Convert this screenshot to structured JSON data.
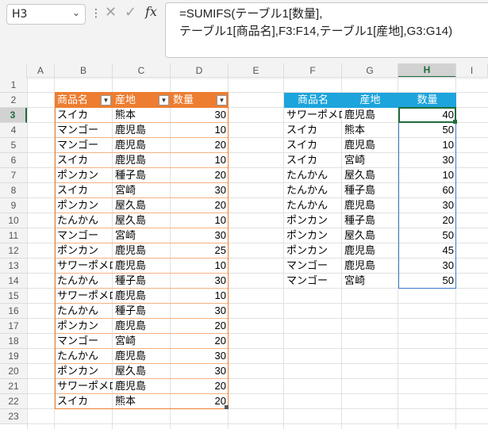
{
  "name_box": {
    "value": "H3"
  },
  "formula_bar": {
    "separator": "⋮",
    "cancel_icon": "✕",
    "confirm_icon": "✓",
    "fx_label": "fx",
    "formula": "=SUMIFS(テーブル1[数量],\nテーブル1[商品名],F3:F14,テーブル1[産地],G3:G14)"
  },
  "columns": [
    "A",
    "B",
    "C",
    "D",
    "E",
    "F",
    "G",
    "H",
    "I"
  ],
  "selected_column": "H",
  "rows": [
    "1",
    "2",
    "3",
    "4",
    "5",
    "6",
    "7",
    "8",
    "9",
    "10",
    "11",
    "12",
    "13",
    "14",
    "15",
    "16",
    "17",
    "18",
    "19",
    "20",
    "21",
    "22",
    "23"
  ],
  "selected_row": "3",
  "table1": {
    "headers": [
      "商品名",
      "産地",
      "数量"
    ],
    "dropdown_icon": "▼",
    "rows": [
      [
        "スイカ",
        "熊本",
        "30"
      ],
      [
        "マンゴー",
        "鹿児島",
        "10"
      ],
      [
        "マンゴー",
        "鹿児島",
        "20"
      ],
      [
        "スイカ",
        "鹿児島",
        "10"
      ],
      [
        "ポンカン",
        "種子島",
        "20"
      ],
      [
        "スイカ",
        "宮崎",
        "30"
      ],
      [
        "ポンカン",
        "屋久島",
        "20"
      ],
      [
        "たんかん",
        "屋久島",
        "10"
      ],
      [
        "マンゴー",
        "宮崎",
        "30"
      ],
      [
        "ポンカン",
        "鹿児島",
        "25"
      ],
      [
        "サワーポメロ",
        "鹿児島",
        "10"
      ],
      [
        "たんかん",
        "種子島",
        "30"
      ],
      [
        "サワーポメロ",
        "鹿児島",
        "10"
      ],
      [
        "たんかん",
        "種子島",
        "30"
      ],
      [
        "ポンカン",
        "鹿児島",
        "20"
      ],
      [
        "マンゴー",
        "宮崎",
        "20"
      ],
      [
        "たんかん",
        "鹿児島",
        "30"
      ],
      [
        "ポンカン",
        "屋久島",
        "30"
      ],
      [
        "サワーポメロ",
        "鹿児島",
        "20"
      ],
      [
        "スイカ",
        "熊本",
        "20"
      ]
    ]
  },
  "summary": {
    "headers": [
      "商品名",
      "産地",
      "数量"
    ],
    "rows": [
      [
        "サワーポメロ",
        "鹿児島",
        "40"
      ],
      [
        "スイカ",
        "熊本",
        "50"
      ],
      [
        "スイカ",
        "鹿児島",
        "10"
      ],
      [
        "スイカ",
        "宮崎",
        "30"
      ],
      [
        "たんかん",
        "屋久島",
        "10"
      ],
      [
        "たんかん",
        "種子島",
        "60"
      ],
      [
        "たんかん",
        "鹿児島",
        "30"
      ],
      [
        "ポンカン",
        "種子島",
        "20"
      ],
      [
        "ポンカン",
        "屋久島",
        "50"
      ],
      [
        "ポンカン",
        "鹿児島",
        "45"
      ],
      [
        "マンゴー",
        "鹿児島",
        "30"
      ],
      [
        "マンゴー",
        "宮崎",
        "50"
      ]
    ]
  },
  "colors": {
    "table1_header": "#ed7d31",
    "summary_header": "#1da4dc",
    "selection": "#1e6c3a"
  }
}
